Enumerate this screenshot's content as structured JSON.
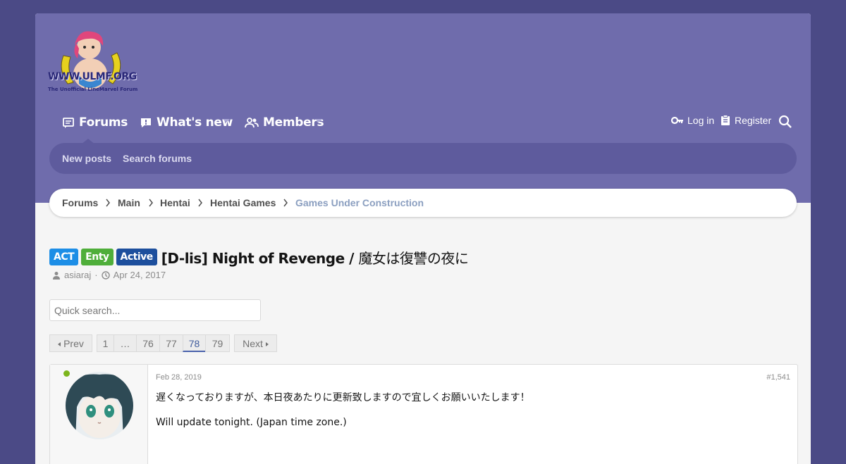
{
  "colors": {
    "header": "#6f6cac",
    "accent": "#4b4a86",
    "label_act": "#1d8ee6",
    "label_enty": "#4fae3a",
    "label_active": "#1d4f9d"
  },
  "logo": {
    "text": "WWW.ULMF.ORG",
    "subtext": "The Unofficial LineMarvel Forum"
  },
  "nav": {
    "tabs": [
      {
        "label": "Forums",
        "icon": "forum-icon"
      },
      {
        "label": "What's new",
        "icon": "whats-new-icon"
      },
      {
        "label": "Members",
        "icon": "members-icon"
      }
    ],
    "login_label": "Log in",
    "register_label": "Register"
  },
  "subnav": {
    "items": [
      "New posts",
      "Search forums"
    ]
  },
  "breadcrumb": [
    "Forums",
    "Main",
    "Hentai",
    "Hentai Games",
    "Games Under Construction"
  ],
  "thread": {
    "labels": [
      "ACT",
      "Enty",
      "Active"
    ],
    "title_en": "[D-lis] Night of Revenge",
    "title_sep": " / ",
    "title_jp": "魔女は復讐の夜に",
    "author": "asiaraj",
    "date": "Apr 24, 2017"
  },
  "quick_search": {
    "placeholder": "Quick search..."
  },
  "pagination": {
    "prev": "Prev",
    "pages": [
      "1",
      "…",
      "76",
      "77",
      "78",
      "79"
    ],
    "current": "78",
    "next": "Next"
  },
  "post": {
    "date": "Feb 28, 2019",
    "number": "#1,541",
    "line1": "遅くなっておりますが、本日夜あたりに更新致しますので宜しくお願いいたします！",
    "line2": "Will update tonight. (Japan time zone.)"
  }
}
